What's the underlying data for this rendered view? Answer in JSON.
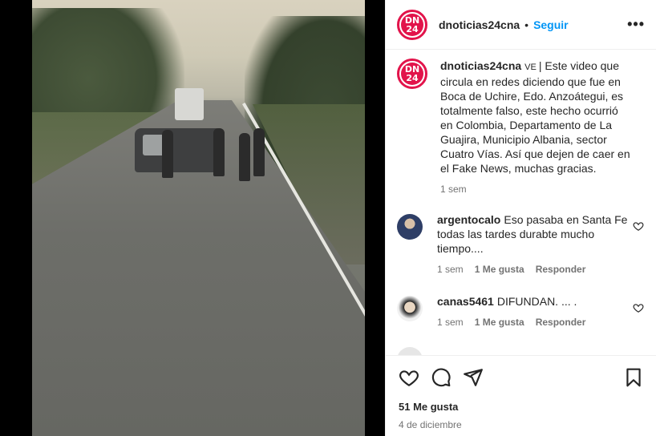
{
  "post": {
    "username": "dnoticias24cna",
    "follow_label": "Seguir",
    "more_label": "•••",
    "logo_text_top": "DN",
    "logo_text_bottom": "24"
  },
  "caption": {
    "username": "dnoticias24cna",
    "verified_mark": "VE",
    "text": "| Este video que circula en redes diciendo que fue en Boca de Uchire, Edo. Anzoátegui, es totalmente falso, este hecho ocurrió en Colombia, Departamento de La Guajira, Municipio Albania, sector Cuatro Vías. Así que dejen de caer en el Fake News, muchas gracias.",
    "time": "1 sem"
  },
  "comments": [
    {
      "username": "argentocalo",
      "text": "Eso pasaba en Santa Fe todas las tardes durabte mucho tiempo....",
      "time": "1 sem",
      "likes": "1 Me gusta",
      "reply_label": "Responder"
    },
    {
      "username": "canas5461",
      "text": "DIFUNDAN. ... .",
      "time": "1 sem",
      "likes": "1 Me gusta",
      "reply_label": "Responder"
    }
  ],
  "footer": {
    "likes_count": "51 Me gusta",
    "date": "4 de diciembre"
  },
  "icons": [
    "heart-icon",
    "comment-icon",
    "share-icon",
    "bookmark-icon",
    "more-icon"
  ],
  "colors": {
    "accent": "#0095f6",
    "brand": "#e2144b",
    "muted": "#737373"
  }
}
